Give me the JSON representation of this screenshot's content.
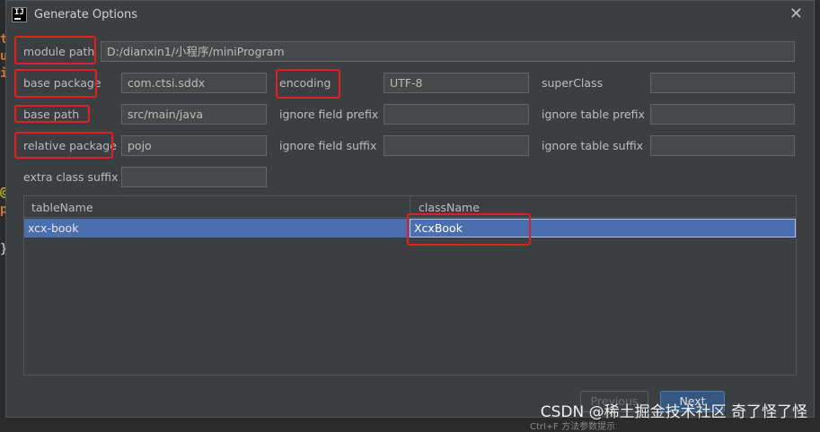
{
  "editor_edge": {
    "chars": [
      "t",
      "u",
      "i",
      "@",
      "p",
      "}"
    ]
  },
  "dialog": {
    "title": "Generate Options"
  },
  "form": {
    "module_path": {
      "label": "module path",
      "value": "D:/dianxin1/小程序/miniProgram"
    },
    "base_package": {
      "label": "base package",
      "value": "com.ctsi.sddx"
    },
    "encoding": {
      "label": "encoding",
      "value": "UTF-8"
    },
    "super_class": {
      "label": "superClass",
      "value": ""
    },
    "base_path": {
      "label": "base path",
      "value": "src/main/java"
    },
    "ignore_field_prefix": {
      "label": "ignore field prefix",
      "value": ""
    },
    "ignore_table_prefix": {
      "label": "ignore table prefix",
      "value": ""
    },
    "relative_package": {
      "label": "relative package",
      "value": "pojo"
    },
    "ignore_field_suffix": {
      "label": "ignore field suffix",
      "value": ""
    },
    "ignore_table_suffix": {
      "label": "ignore table suffix",
      "value": ""
    },
    "extra_class_suffix": {
      "label": "extra class suffix",
      "value": ""
    }
  },
  "table": {
    "columns": [
      "tableName",
      "className"
    ],
    "rows": [
      {
        "tableName": "xcx-book",
        "className": "XcxBook"
      }
    ]
  },
  "buttons": {
    "previous": "Previous",
    "next": "Next"
  },
  "watermark": "CSDN @稀土掘金技术社区 奇了怪了怪",
  "bottom_hint": "Ctrl+F 方法参数提示",
  "colors": {
    "highlight": "#e02020",
    "selection": "#4b6eaf",
    "background": "#3c3f41"
  }
}
